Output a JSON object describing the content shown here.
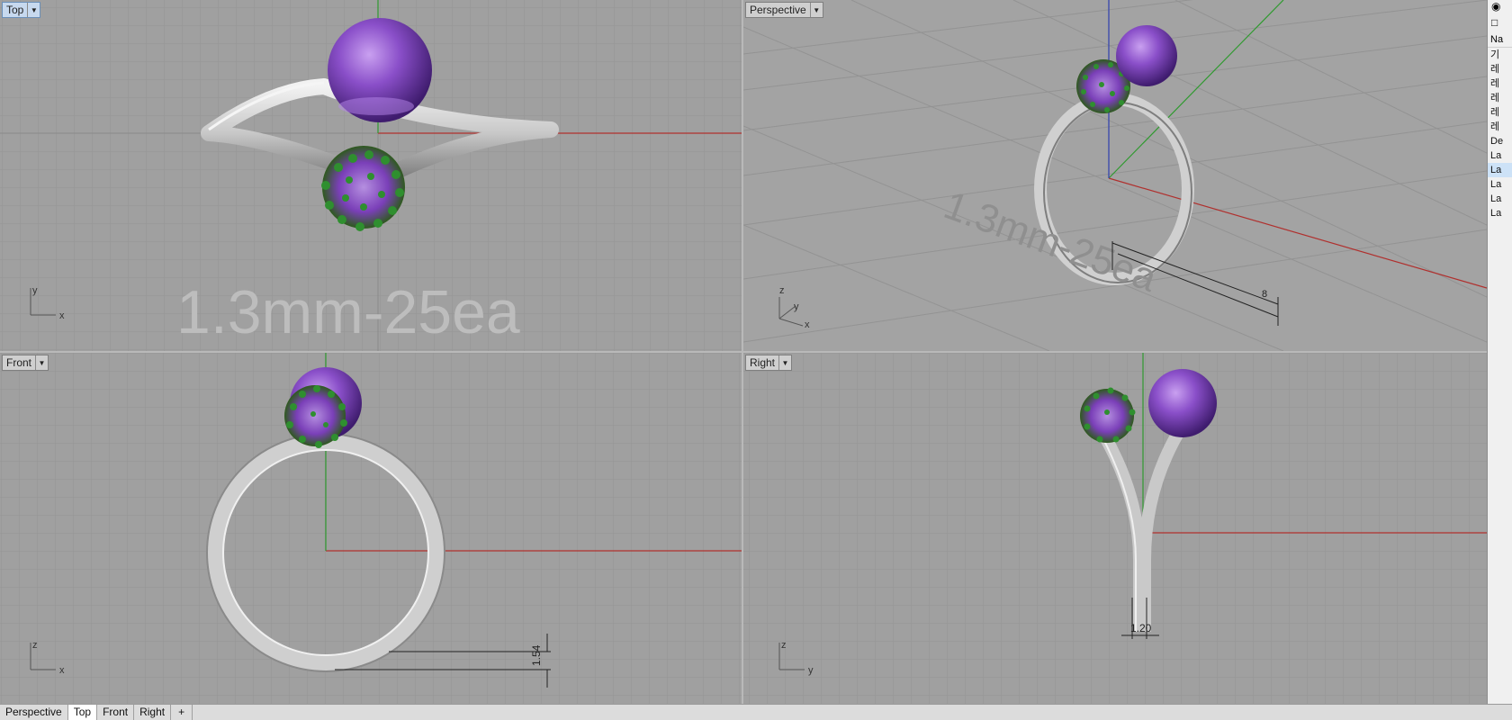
{
  "viewports": {
    "top": {
      "label": "Top",
      "annotation": "1.3mm-25ea",
      "axis_a": "y",
      "axis_b": "x"
    },
    "perspective": {
      "label": "Perspective",
      "annotation": "1.3mm-25ea",
      "axis_z": "z",
      "axis_y": "y",
      "axis_x": "x",
      "dim": "8"
    },
    "front": {
      "label": "Front",
      "axis_a": "z",
      "axis_b": "x",
      "dim": "1.54"
    },
    "right": {
      "label": "Right",
      "axis_a": "z",
      "axis_b": "y",
      "dim": "1.20"
    }
  },
  "layers_panel": {
    "header": "Na",
    "rows": [
      "기",
      "레",
      "레",
      "레",
      "레",
      "레",
      "De",
      "La",
      "La",
      "La",
      "La",
      "La"
    ],
    "selected_index": 8
  },
  "tabs": [
    "Perspective",
    "Top",
    "Front",
    "Right"
  ],
  "active_tab": "Top",
  "add_tab": "+",
  "colors": {
    "viewport_bg": "#a0a0a0",
    "grid_minor": "#959595",
    "grid_major": "#8a8a8a",
    "x_axis": "#b0302e",
    "y_axis": "#2f9a2f",
    "z_axis": "#2f3fb0",
    "metal": "#d4d4d4",
    "amethyst": "#8a4fc9",
    "green_stone": "#2e8a2e"
  }
}
